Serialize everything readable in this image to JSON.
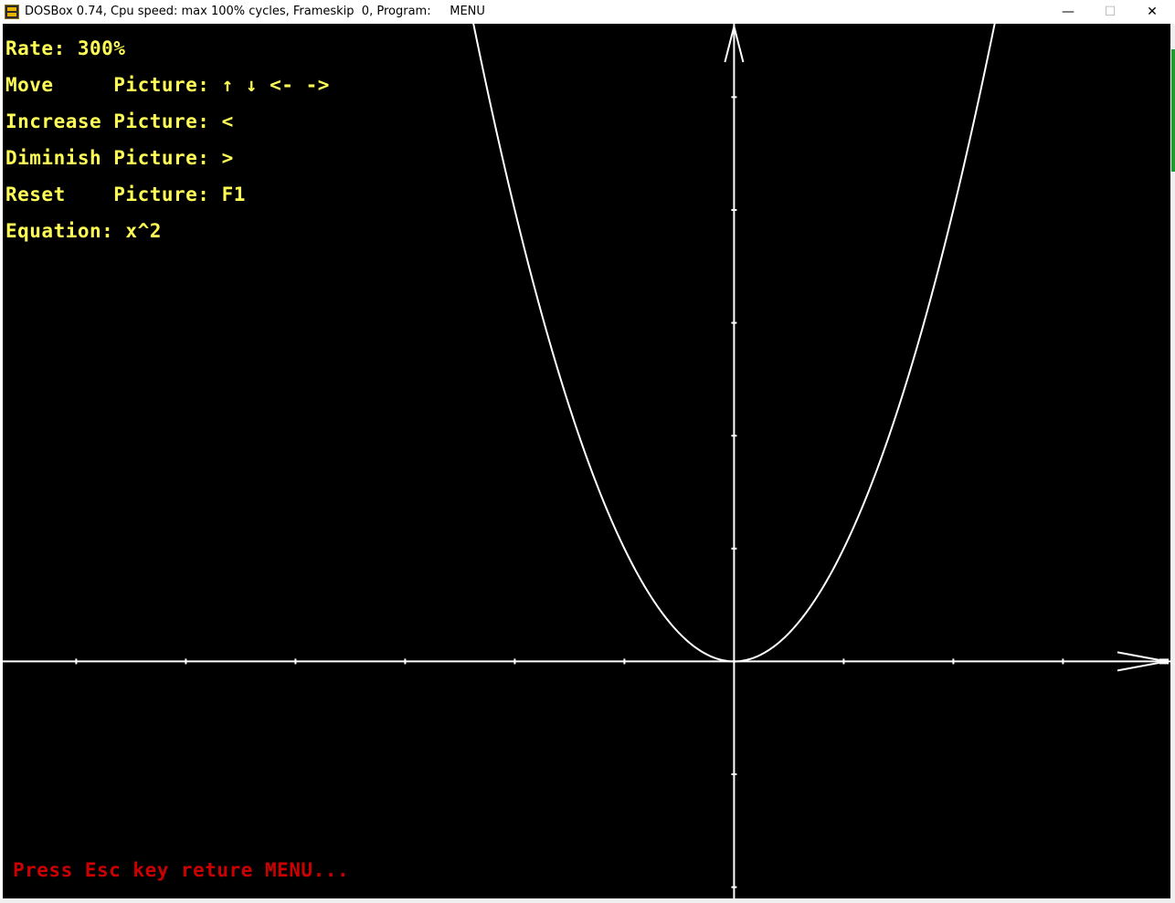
{
  "window": {
    "title": "DOSBox 0.74, Cpu speed: max 100% cycles, Frameskip  0, Program:     MENU",
    "minimize_glyph": "—",
    "maximize_glyph": "☐",
    "close_glyph": "✕",
    "icon": "dosbox-icon"
  },
  "screen": {
    "rate_line": "Rate: 300%",
    "move_line": "Move     Picture: ↑ ↓ <- ->",
    "increase_line": "Increase Picture: <",
    "diminish_line": "Diminish Picture: >",
    "reset_line": "Reset    Picture: F1",
    "equation_line": "Equation: x^2",
    "footer_line": "Press Esc key reture MENU...",
    "text_color": "#ffff55",
    "footer_color": "#cc0000",
    "background": "#000000",
    "curve_color": "#ffffff"
  },
  "chart_data": {
    "type": "line",
    "title": "",
    "xlabel": "",
    "ylabel": "",
    "equation": "x^2",
    "xlim": [
      -6.67,
      3.98
    ],
    "ylim": [
      -2.1,
      5.65
    ],
    "x_ticks": [
      -6,
      -5,
      -4,
      -3,
      -2,
      -1,
      1,
      2,
      3
    ],
    "y_ticks": [
      -2,
      -1,
      1,
      2,
      3,
      4,
      5
    ],
    "grid": false,
    "series": [
      {
        "values_function": "x^2",
        "x_range": [
          -2.4,
          2.4
        ]
      }
    ]
  }
}
